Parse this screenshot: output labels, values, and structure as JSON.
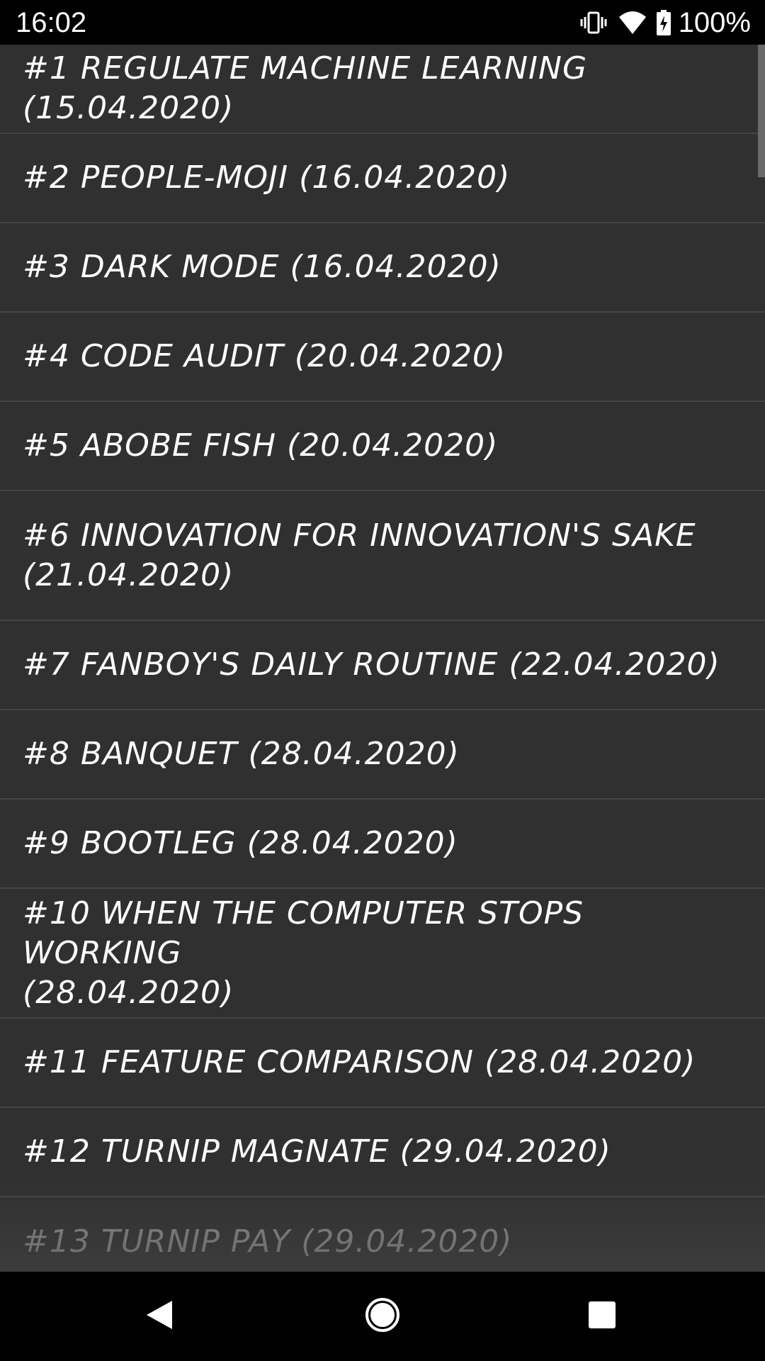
{
  "status_bar": {
    "time": "16:02",
    "battery_percent": "100%",
    "icons": [
      "vibrate-icon",
      "wifi-icon",
      "battery-charging-icon"
    ]
  },
  "list": {
    "items": [
      {
        "label": "#1 REGULATE MACHINE LEARNING (15.04.2020)"
      },
      {
        "label": "#2 PEOPLE-MOJI (16.04.2020)"
      },
      {
        "label": "#3 DARK MODE (16.04.2020)"
      },
      {
        "label": "#4 CODE AUDIT (20.04.2020)"
      },
      {
        "label": "#5 ABOBE FISH (20.04.2020)"
      },
      {
        "label": "#6 INNOVATION FOR INNOVATION'S SAKE\n(21.04.2020)"
      },
      {
        "label": "#7 FANBOY'S DAILY ROUTINE (22.04.2020)"
      },
      {
        "label": "#8 BANQUET (28.04.2020)"
      },
      {
        "label": "#9 BOOTLEG (28.04.2020)"
      },
      {
        "label": "#10 WHEN THE COMPUTER STOPS WORKING\n(28.04.2020)"
      },
      {
        "label": "#11 FEATURE COMPARISON (28.04.2020)"
      },
      {
        "label": "#12 TURNIP MAGNATE (29.04.2020)"
      },
      {
        "label": "#13 TURNIP PAY (29.04.2020)"
      }
    ]
  },
  "nav_bar": {
    "icons": [
      "back-icon",
      "home-icon",
      "recents-icon"
    ]
  },
  "colors": {
    "background": "#303030",
    "divider": "#454545",
    "text": "#ffffff"
  }
}
